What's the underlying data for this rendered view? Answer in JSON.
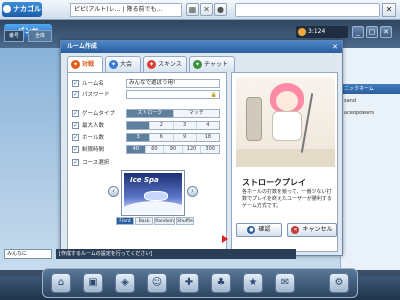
{
  "top": {
    "logo": "ナカゴルフ",
    "ticker": "ピピ(アルト)レ… | 降る前でも…",
    "icons": [
      "film-icon",
      "close-icon",
      "ball-icon",
      "close-icon"
    ]
  },
  "appbar": {
    "logo": "パンヤ",
    "tab1": "番号",
    "tab2": "全体",
    "points": "3:124",
    "buttons": [
      "minus-icon",
      "settings-icon",
      "close-icon"
    ]
  },
  "dialog": {
    "title": "ルーム作成",
    "tabs": [
      {
        "label": "対戦",
        "icon_color": "#e35b14"
      },
      {
        "label": "大会",
        "icon_color": "#3c7bd0"
      },
      {
        "label": "スキンス",
        "icon_color": "#d9403a"
      },
      {
        "label": "チャット",
        "icon_color": "#3c8f3c"
      }
    ],
    "form": {
      "room_name_label": "ルーム名",
      "room_name_value": "みんなで遊ぼう用!",
      "password_label": "パスワード",
      "gametype_label": "ゲームタイプ",
      "gametype_options": [
        "ストローク",
        "マッチ"
      ],
      "gametype_selected": 0,
      "max_label": "最大人数",
      "max_options": [
        "",
        "2",
        "3",
        "4"
      ],
      "max_selected": 0,
      "holes_label": "ホール数",
      "holes_options": [
        "3",
        "6",
        "9",
        "18"
      ],
      "holes_selected": 0,
      "time_label": "制限時間",
      "time_options": [
        "40",
        "60",
        "90",
        "120",
        "300"
      ],
      "time_selected": 0,
      "course_label": "コース選択",
      "course_name": "Ice Spa",
      "sort_options": [
        "Front",
        "Back",
        "Random",
        "Shuffle"
      ],
      "sort_selected": 0
    },
    "preview": {
      "mode_title": "ストロークプレイ",
      "mode_desc": "各ホールの打数を競って、一番少ない打数でプレイを終えたユーザーが勝利するゲーム方式です。",
      "confirm": "確認",
      "cancel": "キャンセル"
    }
  },
  "right_panel": {
    "header": "ニックネーム",
    "items": [
      "sand",
      "aceopowers"
    ]
  },
  "bottom": {
    "chat_name": "みんなに",
    "status": "[作成するルームの設定を行ってください]"
  }
}
